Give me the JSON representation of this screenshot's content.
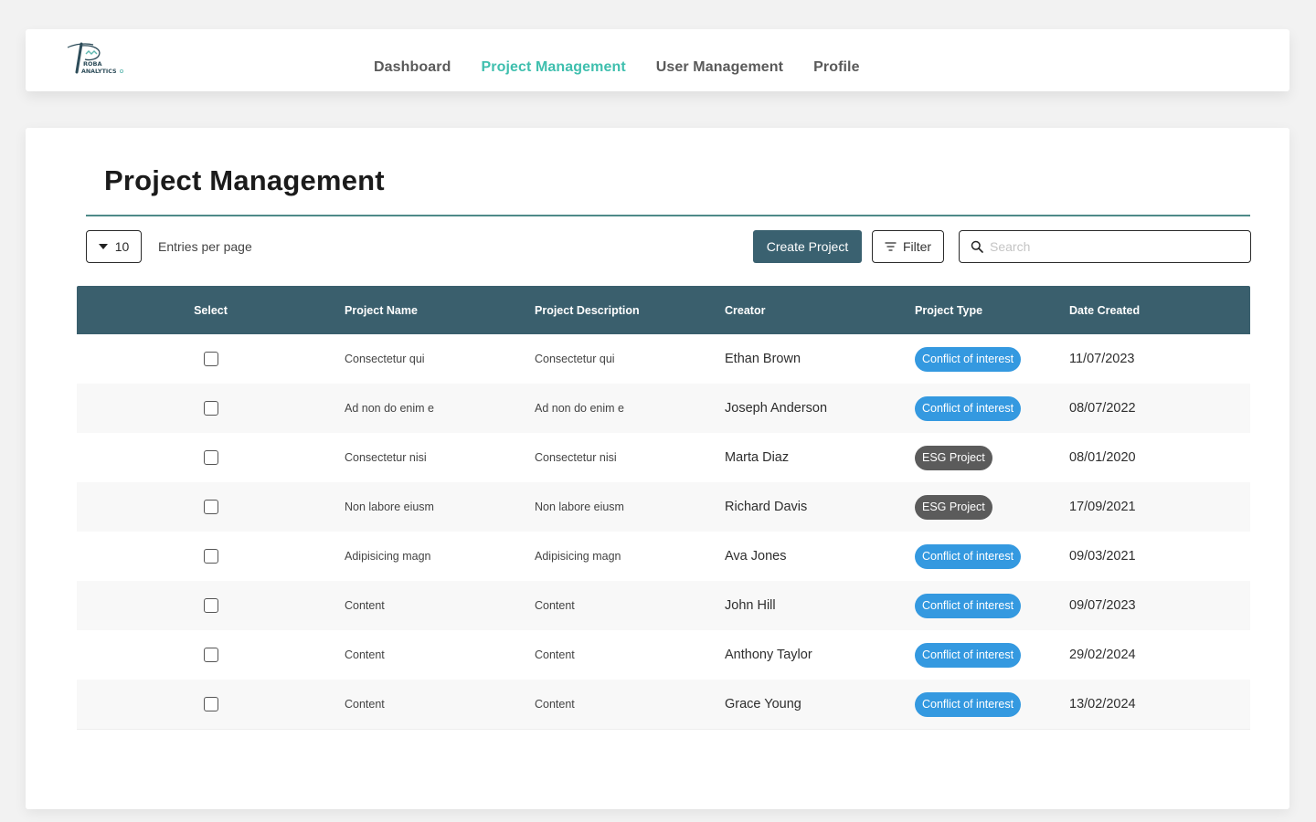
{
  "brand": {
    "logo_line1": "ROBA",
    "logo_line2": "ANALYTICS"
  },
  "nav": {
    "items": [
      {
        "label": "Dashboard",
        "active": false
      },
      {
        "label": "Project Management",
        "active": true
      },
      {
        "label": "User Management",
        "active": false
      },
      {
        "label": "Profile",
        "active": false
      }
    ]
  },
  "colors": {
    "nav_active": "#3fbfae",
    "header_bg": "#3a5f6d",
    "primary_button": "#3a6170",
    "badge_conflict": "#3499e0",
    "badge_esg": "#5b5b5b",
    "title_rule": "#4e8a89"
  },
  "page": {
    "title": "Project Management"
  },
  "toolbar": {
    "entries_value": "10",
    "entries_label": "Entries per page",
    "create_label": "Create Project",
    "filter_label": "Filter",
    "search_placeholder": "Search",
    "search_value": ""
  },
  "table": {
    "columns": [
      "Select",
      "Project Name",
      "Project Description",
      "Creator",
      "Project Type",
      "Date Created"
    ],
    "rows": [
      {
        "selected": false,
        "name": "Consectetur qui",
        "description": "Consectetur qui",
        "creator": "Ethan Brown",
        "type": "Conflict of interest",
        "type_kind": "coi",
        "date": "11/07/2023"
      },
      {
        "selected": false,
        "name": "Ad non do enim e",
        "description": "Ad non do enim e",
        "creator": "Joseph Anderson",
        "type": "Conflict of interest",
        "type_kind": "coi",
        "date": "08/07/2022"
      },
      {
        "selected": false,
        "name": "Consectetur nisi",
        "description": "Consectetur nisi",
        "creator": "Marta Diaz",
        "type": "ESG Project",
        "type_kind": "esg",
        "date": "08/01/2020"
      },
      {
        "selected": false,
        "name": "Non labore eiusm",
        "description": "Non labore eiusm",
        "creator": "Richard Davis",
        "type": "ESG Project",
        "type_kind": "esg",
        "date": "17/09/2021"
      },
      {
        "selected": false,
        "name": "Adipisicing magn",
        "description": "Adipisicing magn",
        "creator": "Ava Jones",
        "type": "Conflict of interest",
        "type_kind": "coi",
        "date": "09/03/2021"
      },
      {
        "selected": false,
        "name": "Content",
        "description": "Content",
        "creator": "John Hill",
        "type": "Conflict of interest",
        "type_kind": "coi",
        "date": "09/07/2023"
      },
      {
        "selected": false,
        "name": "Content",
        "description": "Content",
        "creator": "Anthony Taylor",
        "type": "Conflict of interest",
        "type_kind": "coi",
        "date": "29/02/2024"
      },
      {
        "selected": false,
        "name": "Content",
        "description": "Content",
        "creator": "Grace Young",
        "type": "Conflict of interest",
        "type_kind": "coi",
        "date": "13/02/2024"
      }
    ]
  }
}
